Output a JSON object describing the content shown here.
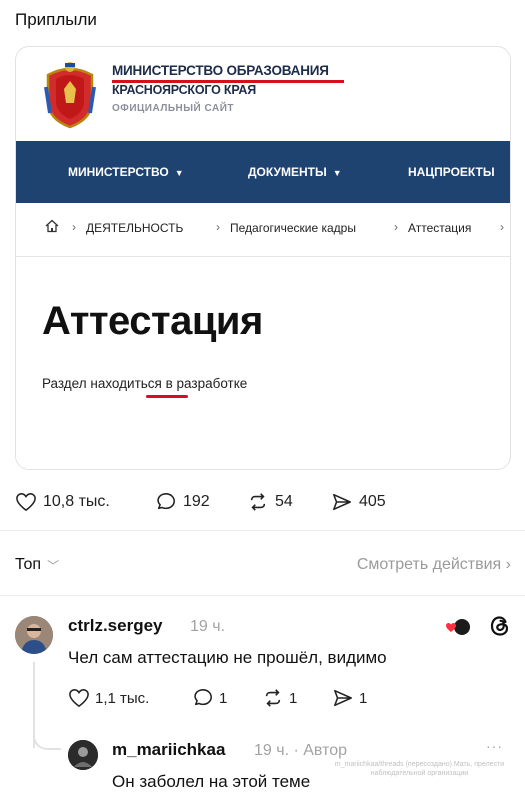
{
  "post": {
    "caption": "Приплыли"
  },
  "site": {
    "ministry_title": "МИНИСТЕРСТВО ОБРАЗОВАНИЯ",
    "region": "КРАСНОЯРСКОГО КРАЯ",
    "official": "ОФИЦИАЛЬНЫЙ САЙТ",
    "nav": [
      "МИНИСТЕРСТВО",
      "ДОКУМЕНТЫ",
      "НАЦПРОЕКТЫ"
    ],
    "breadcrumb": [
      "ДЕЯТЕЛЬНОСТЬ",
      "Педагогические кадры",
      "Аттестация"
    ],
    "heading": "Аттестация",
    "text_before": "Раздел ",
    "text_mistake": "находиться",
    "text_after": " в разработке",
    "accent_color": "#d4101c",
    "nav_color": "#1f4371"
  },
  "stats": {
    "likes": "10,8 тыс.",
    "replies": "192",
    "reposts": "54",
    "shares": "405"
  },
  "sort": {
    "label": "Топ",
    "activity": "Смотреть действия"
  },
  "comments": [
    {
      "username": "ctrlz.sergey",
      "time": "19 ч.",
      "text": "Чел сам аттестацию не прошёл, видимо",
      "likes": "1,1 тыс.",
      "replies": "1",
      "reposts": "1",
      "shares": "1"
    },
    {
      "username": "m_mariichkaa",
      "time": "19 ч. · Автор",
      "text": "Он заболел на этой теме",
      "more": "···"
    }
  ],
  "watermark": "m_mariichkaa/threads (пересоздано) Мать, прелести наблюдательной организации"
}
